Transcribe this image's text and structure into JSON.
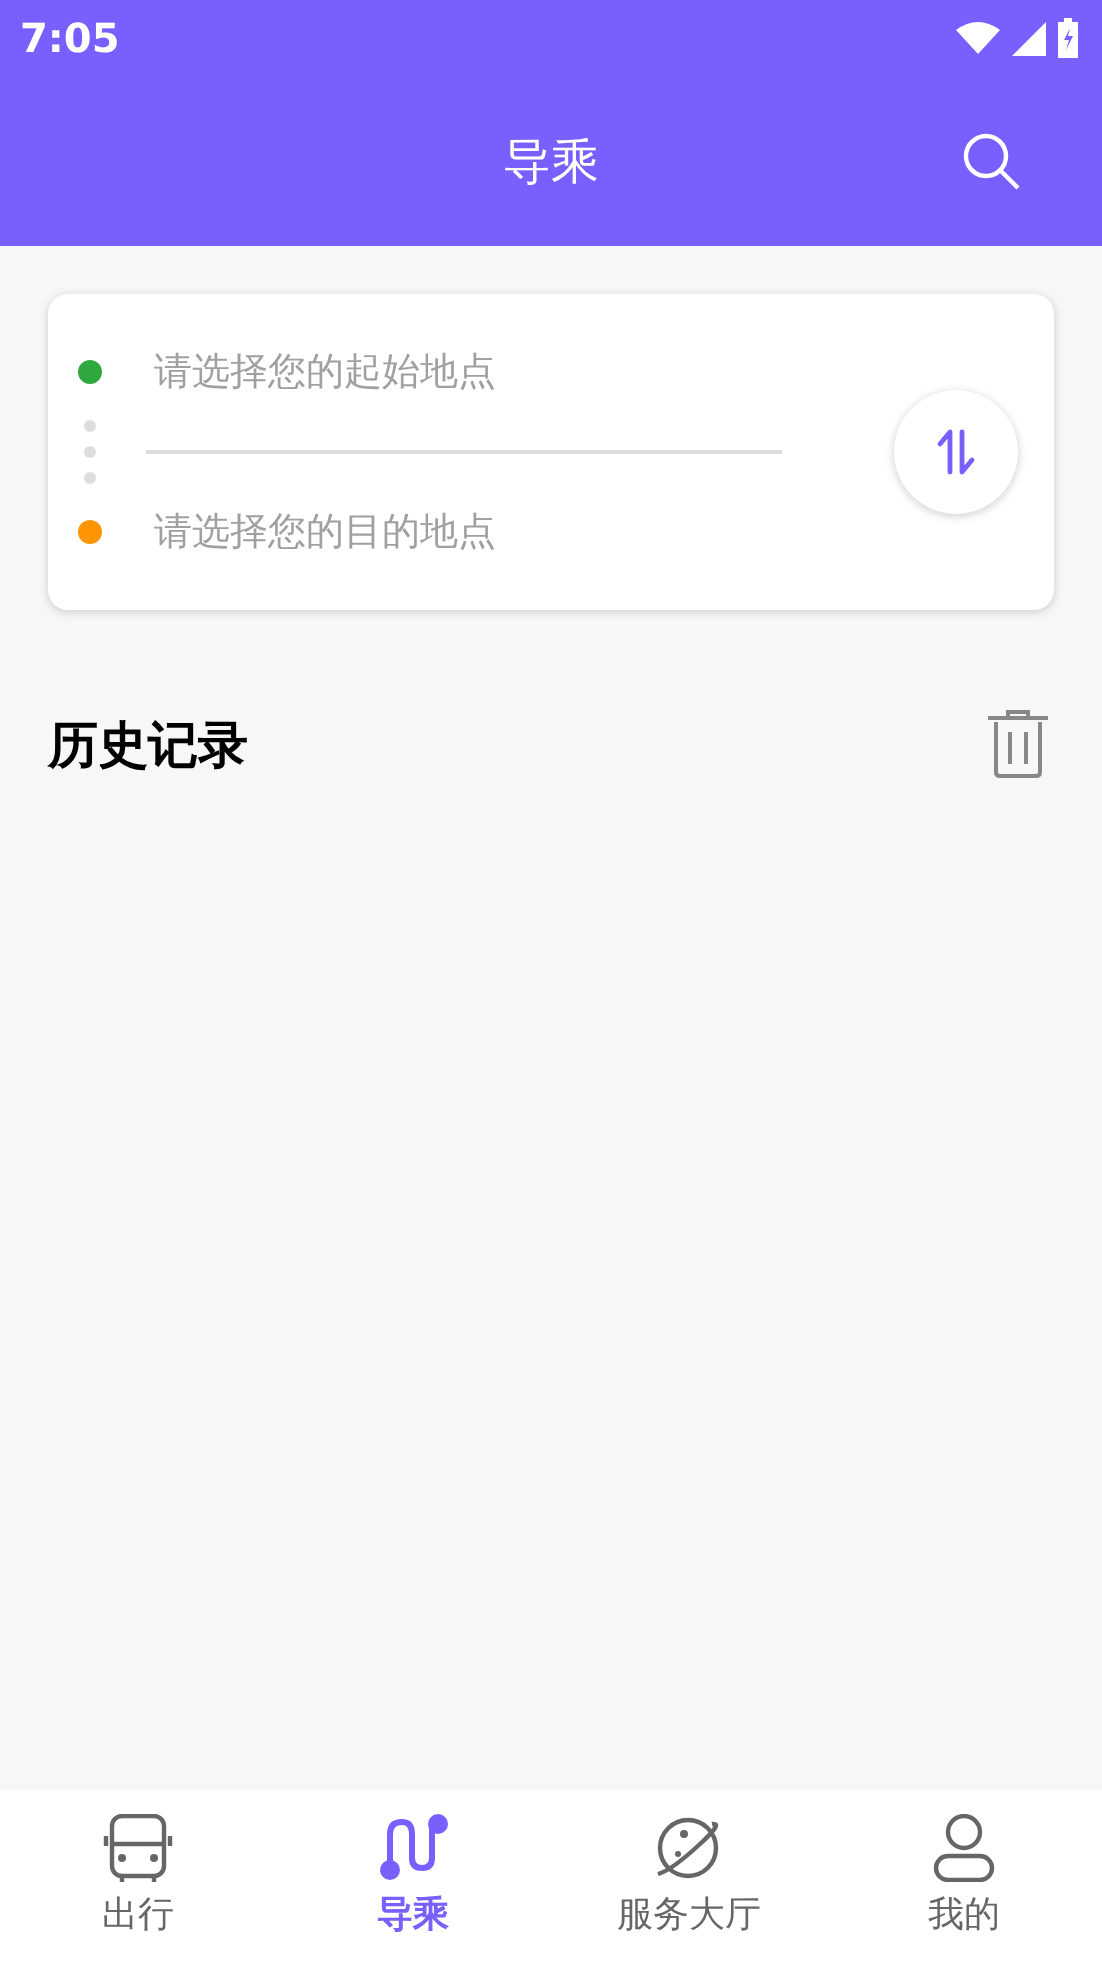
{
  "status_bar": {
    "time": "7:05"
  },
  "app_bar": {
    "title": "导乘"
  },
  "route_card": {
    "fields": [
      {
        "placeholder": "请选择您的起始地点",
        "color": "#2ea83f"
      },
      {
        "placeholder": "请选择您的目的地点",
        "color": "#ff9500"
      }
    ]
  },
  "history": {
    "title": "历史记录"
  },
  "bottom_nav": [
    {
      "label": "出行",
      "kind": "bus",
      "selected": false
    },
    {
      "label": "导乘",
      "kind": "route",
      "selected": true
    },
    {
      "label": "服务大厅",
      "kind": "planet",
      "selected": false
    },
    {
      "label": "我的",
      "kind": "person",
      "selected": false
    }
  ]
}
